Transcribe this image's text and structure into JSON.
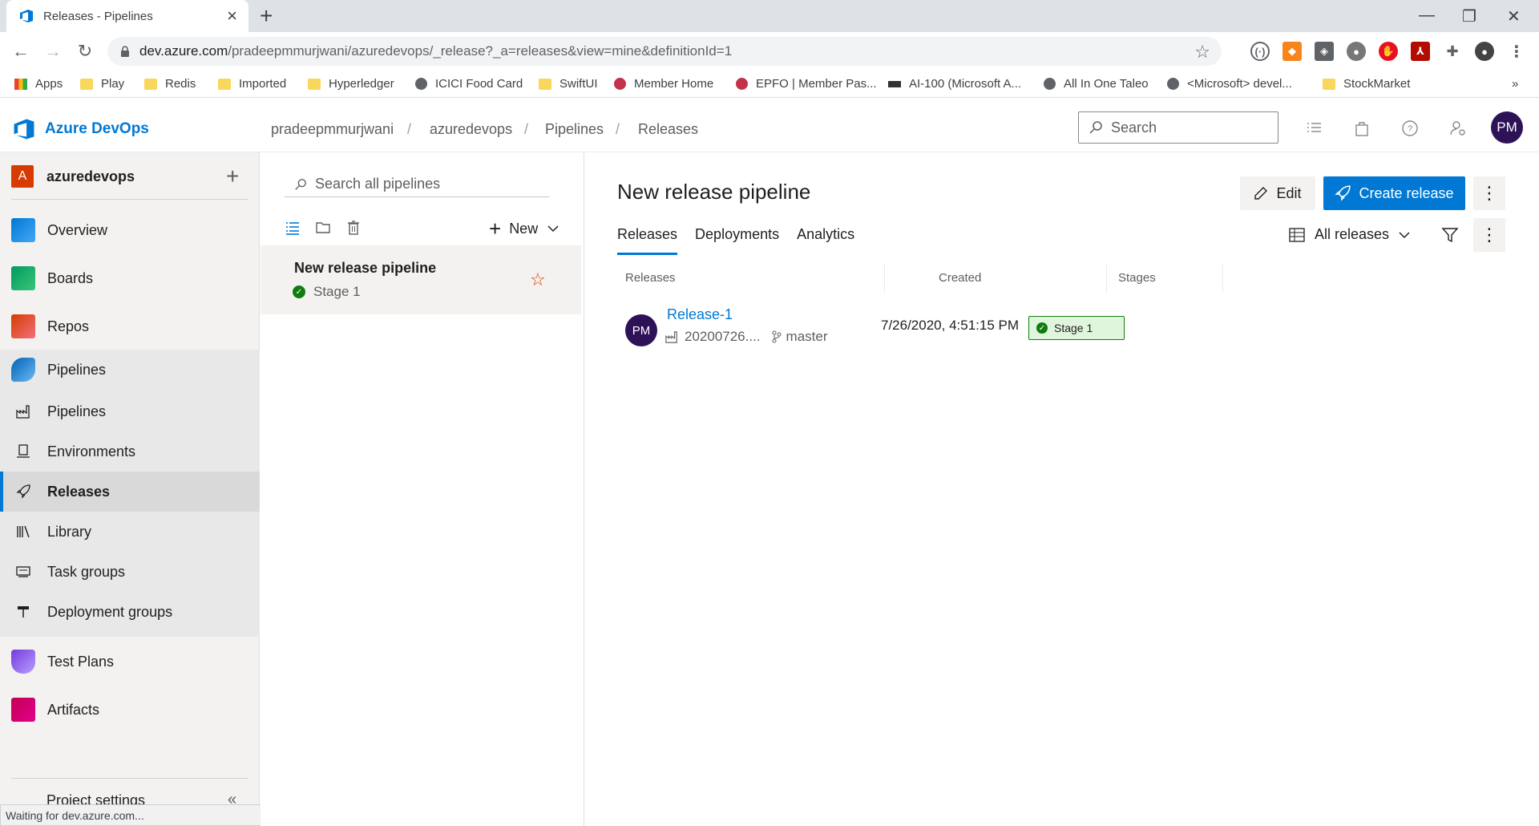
{
  "browser": {
    "tab_title": "Releases - Pipelines",
    "url_host": "dev.azure.com",
    "url_path": "/pradeepmmurjwani/azuredevops/_release?_a=releases&view=mine&definitionId=1",
    "status_text": "Waiting for dev.azure.com..."
  },
  "bookmarks": [
    "Apps",
    "Play",
    "Redis",
    "Imported",
    "Hyperledger",
    "ICICI Food Card",
    "SwiftUI",
    "Member Home",
    "EPFO | Member Pas...",
    "AI-100 (Microsoft A...",
    "All In One Taleo",
    "<Microsoft> devel...",
    "StockMarket"
  ],
  "header": {
    "brand": "Azure DevOps",
    "breadcrumb": [
      "pradeepmmurjwani",
      "azuredevops",
      "Pipelines",
      "Releases"
    ],
    "search_placeholder": "Search",
    "user_initials": "PM"
  },
  "sidebar": {
    "project_initial": "A",
    "project_name": "azuredevops",
    "items": [
      "Overview",
      "Boards",
      "Repos",
      "Pipelines",
      "Test Plans",
      "Artifacts"
    ],
    "pipeline_sub": [
      "Pipelines",
      "Environments",
      "Releases",
      "Library",
      "Task groups",
      "Deployment groups"
    ],
    "settings": "Project settings"
  },
  "pipelist": {
    "search_placeholder": "Search all pipelines",
    "new_label": "New",
    "item_name": "New release pipeline",
    "item_stage": "Stage 1"
  },
  "main": {
    "title": "New release pipeline",
    "edit_label": "Edit",
    "create_label": "Create release",
    "tabs": [
      "Releases",
      "Deployments",
      "Analytics"
    ],
    "view_label": "All releases",
    "columns": [
      "Releases",
      "Created",
      "Stages"
    ],
    "release": {
      "initials": "PM",
      "name": "Release-1",
      "build": "20200726....",
      "branch": "master",
      "created": "7/26/2020, 4:51:15 PM",
      "stage": "Stage 1"
    }
  },
  "colors": {
    "accent": "#0078d4",
    "success": "#107c10",
    "avatar": "#2e1257"
  }
}
